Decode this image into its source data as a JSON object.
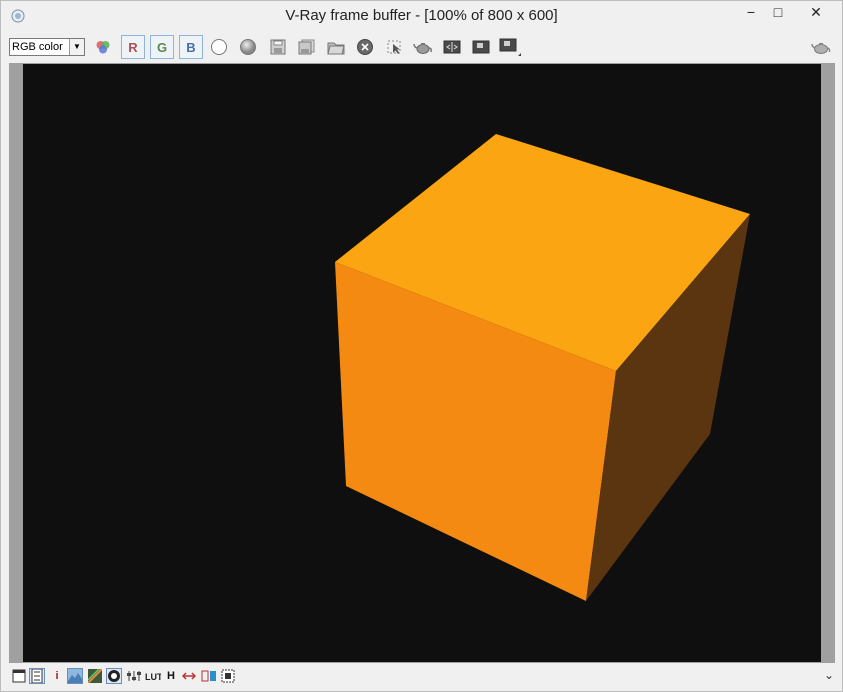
{
  "window": {
    "title": "V-Ray frame buffer - [100% of 800 x 600]",
    "minimize_glyph": "−",
    "maximize_glyph": "□",
    "close_glyph": "✕"
  },
  "toolbar": {
    "channel_select_value": "RGB color",
    "channel_buttons": {
      "r": "R",
      "g": "G",
      "b": "B"
    }
  },
  "render": {
    "background": "#0f0f0f",
    "cube_colors": {
      "top": "#fca512",
      "front": "#f58a12",
      "side": "#5a3510"
    }
  },
  "statusbar": {
    "info_glyph": "i",
    "h_glyph": "H",
    "expand_glyph": "⌄"
  },
  "colors": {
    "accent_frame": "#8fb3d9"
  }
}
